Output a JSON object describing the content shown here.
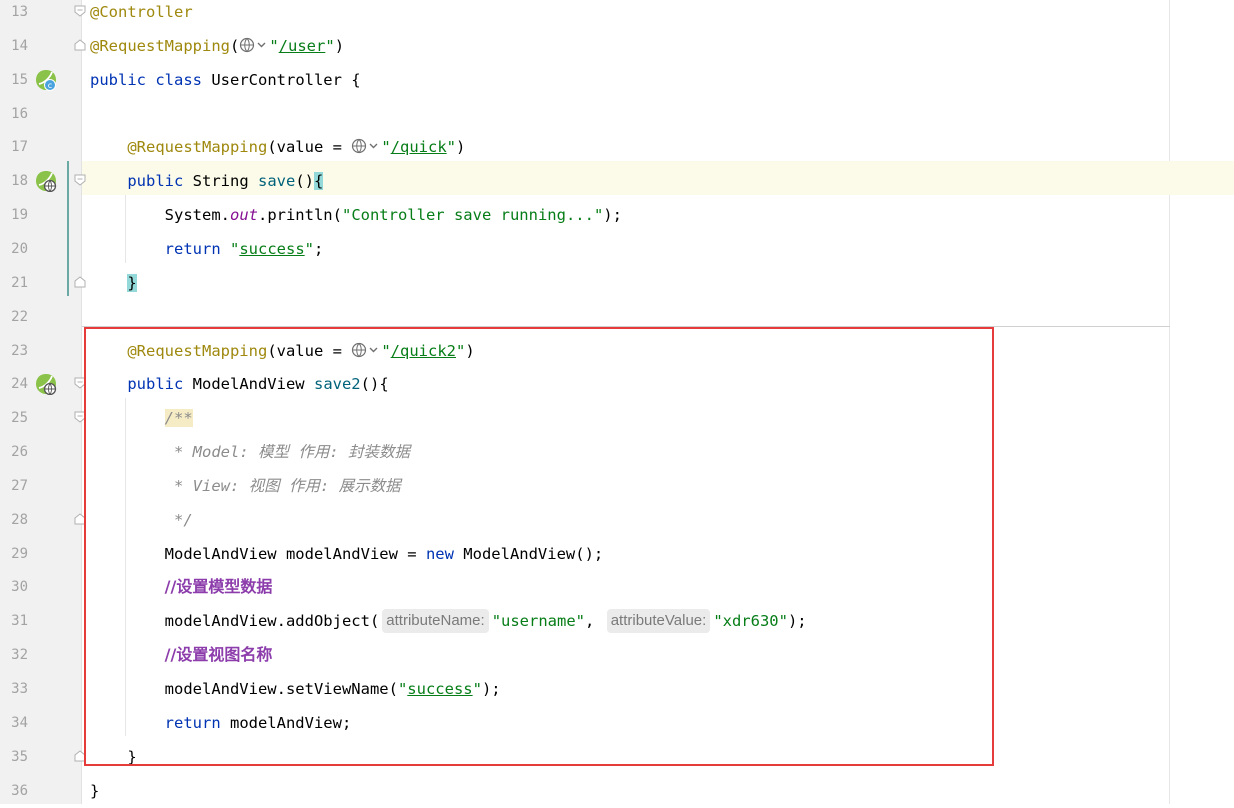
{
  "editor": {
    "lines": [
      {
        "n": "13",
        "tokens": [
          [
            "ann",
            "@Controller"
          ]
        ]
      },
      {
        "n": "14",
        "tokens": [
          [
            "ann",
            "@RequestMapping"
          ],
          [
            "txt",
            "("
          ],
          [
            "globe",
            ""
          ],
          [
            "str",
            "\""
          ],
          [
            "url",
            "/user"
          ],
          [
            "str",
            "\""
          ],
          [
            "txt",
            ")"
          ]
        ]
      },
      {
        "n": "15",
        "tokens": [
          [
            "kw",
            "public class "
          ],
          [
            "txt",
            "UserController {"
          ]
        ]
      },
      {
        "n": "16",
        "tokens": []
      },
      {
        "n": "17",
        "tokens": [
          [
            "txt",
            "    "
          ],
          [
            "ann",
            "@RequestMapping"
          ],
          [
            "txt",
            "(value = "
          ],
          [
            "globe",
            ""
          ],
          [
            "str",
            "\""
          ],
          [
            "url",
            "/quick"
          ],
          [
            "str",
            "\""
          ],
          [
            "txt",
            ")"
          ]
        ]
      },
      {
        "n": "18",
        "tokens": [
          [
            "txt",
            "    "
          ],
          [
            "kw",
            "public "
          ],
          [
            "txt",
            "String "
          ],
          [
            "meth",
            "save"
          ],
          [
            "txt",
            "()"
          ],
          [
            "brace",
            "{"
          ]
        ]
      },
      {
        "n": "19",
        "tokens": [
          [
            "txt",
            "        System."
          ],
          [
            "fld",
            "out"
          ],
          [
            "txt",
            ".println("
          ],
          [
            "str",
            "\"Controller save running...\""
          ],
          [
            "txt",
            ");"
          ]
        ]
      },
      {
        "n": "20",
        "tokens": [
          [
            "txt",
            "        "
          ],
          [
            "kw",
            "return "
          ],
          [
            "str",
            "\""
          ],
          [
            "url",
            "success"
          ],
          [
            "str",
            "\""
          ],
          [
            "txt",
            ";"
          ]
        ]
      },
      {
        "n": "21",
        "tokens": [
          [
            "txt",
            "    "
          ],
          [
            "brace",
            "}"
          ]
        ]
      },
      {
        "n": "22",
        "tokens": []
      },
      {
        "n": "23",
        "tokens": [
          [
            "txt",
            "    "
          ],
          [
            "ann",
            "@RequestMapping"
          ],
          [
            "txt",
            "(value = "
          ],
          [
            "globe",
            ""
          ],
          [
            "str",
            "\""
          ],
          [
            "url",
            "/quick2"
          ],
          [
            "str",
            "\""
          ],
          [
            "txt",
            ")"
          ]
        ]
      },
      {
        "n": "24",
        "tokens": [
          [
            "txt",
            "    "
          ],
          [
            "kw",
            "public "
          ],
          [
            "txt",
            "ModelAndView "
          ],
          [
            "meth",
            "save2"
          ],
          [
            "txt",
            "(){"
          ]
        ]
      },
      {
        "n": "25",
        "tokens": [
          [
            "txt",
            "        "
          ],
          [
            "dochl",
            "/**"
          ]
        ]
      },
      {
        "n": "26",
        "tokens": [
          [
            "txt",
            "         "
          ],
          [
            "cmt",
            "* Model: 模型 作用: 封装数据"
          ]
        ]
      },
      {
        "n": "27",
        "tokens": [
          [
            "txt",
            "         "
          ],
          [
            "cmt",
            "* View: 视图 作用: 展示数据"
          ]
        ]
      },
      {
        "n": "28",
        "tokens": [
          [
            "txt",
            "         "
          ],
          [
            "cmt",
            "*/"
          ]
        ]
      },
      {
        "n": "29",
        "tokens": [
          [
            "txt",
            "        ModelAndView modelAndView = "
          ],
          [
            "kw",
            "new "
          ],
          [
            "txt",
            "ModelAndView();"
          ]
        ]
      },
      {
        "n": "30",
        "tokens": [
          [
            "txt",
            "        "
          ],
          [
            "lcmt",
            "//设置模型数据"
          ]
        ]
      },
      {
        "n": "31",
        "tokens": [
          [
            "txt",
            "        modelAndView.addObject("
          ],
          [
            "hint",
            "attributeName:"
          ],
          [
            "str",
            "\"username\""
          ],
          [
            "txt",
            ", "
          ],
          [
            "hint",
            "attributeValue:"
          ],
          [
            "str",
            "\"xdr630\""
          ],
          [
            "txt",
            ");"
          ]
        ]
      },
      {
        "n": "32",
        "tokens": [
          [
            "txt",
            "        "
          ],
          [
            "lcmt",
            "//设置视图名称"
          ]
        ]
      },
      {
        "n": "33",
        "tokens": [
          [
            "txt",
            "        modelAndView.setViewName("
          ],
          [
            "str",
            "\""
          ],
          [
            "url",
            "success"
          ],
          [
            "str",
            "\""
          ],
          [
            "txt",
            ");"
          ]
        ]
      },
      {
        "n": "34",
        "tokens": [
          [
            "txt",
            "        "
          ],
          [
            "kw",
            "return "
          ],
          [
            "txt",
            "modelAndView;"
          ]
        ]
      },
      {
        "n": "35",
        "tokens": [
          [
            "txt",
            "    }"
          ]
        ]
      },
      {
        "n": "36",
        "tokens": [
          [
            "txt",
            "}"
          ]
        ]
      }
    ],
    "gutter_icons": {
      "15": "spring-bean-class-icon",
      "18": "spring-request-mapping-icon",
      "24": "spring-request-mapping-icon"
    },
    "fold_markers": {
      "13": "start",
      "14": "end",
      "18": "start",
      "21": "end",
      "24": "start",
      "25": "start",
      "28": "end",
      "35": "end"
    },
    "colors": {
      "keyword": "#0033b3",
      "annotation": "#9e880d",
      "string": "#067d17",
      "static_field": "#871094",
      "method": "#00627a",
      "doc_comment": "#8c8c8c",
      "line_comment": "#8c3dab",
      "highlight_box": "#e53b3b",
      "caret_line": "#fcfbe9"
    }
  }
}
